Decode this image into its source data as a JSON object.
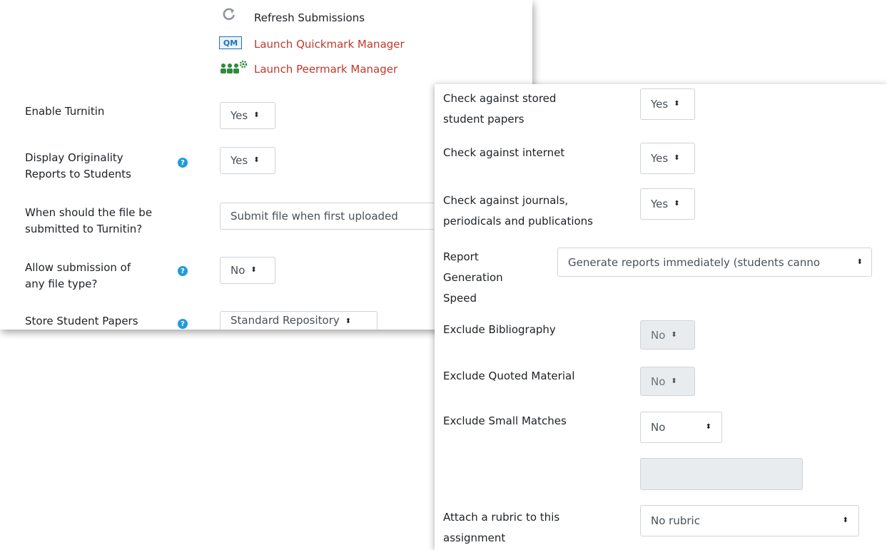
{
  "links": {
    "refresh": "Refresh Submissions",
    "quickmark": "Launch Quickmark Manager",
    "quickmark_badge": "QM",
    "peermark": "Launch Peermark Manager"
  },
  "left": {
    "enable_turnitin": {
      "label": "Enable Turnitin",
      "value": "Yes"
    },
    "display_reports": {
      "label_1": "Display Originality",
      "label_2": "Reports to Students",
      "value": "Yes"
    },
    "when_submit": {
      "label_1": "When should the file be",
      "label_2": "submitted to Turnitin?",
      "value": "Submit file when first uploaded"
    },
    "allow_any": {
      "label_1": "Allow submission of",
      "label_2": "any file type?",
      "value": "No"
    },
    "store_papers": {
      "label": "Store Student Papers",
      "value": "Standard Repository"
    }
  },
  "right": {
    "stored": {
      "label_1": "Check against stored",
      "label_2": "student papers",
      "value": "Yes"
    },
    "internet": {
      "label": "Check against internet",
      "value": "Yes"
    },
    "journals": {
      "label_1": "Check against journals,",
      "label_2": "periodicals and publications",
      "value": "Yes"
    },
    "speed": {
      "label_1": "Report",
      "label_2": "Generation",
      "label_3": "Speed",
      "value": "Generate reports immediately (students canno"
    },
    "bibliography": {
      "label": "Exclude Bibliography",
      "value": "No"
    },
    "quoted": {
      "label": "Exclude Quoted Material",
      "value": "No"
    },
    "small": {
      "label": "Exclude Small Matches",
      "value": "No"
    },
    "rubric": {
      "label_1": "Attach a rubric to this",
      "label_2": "assignment",
      "value": "No rubric"
    }
  },
  "icons": {
    "caret": "⬍",
    "help": "?"
  },
  "colors": {
    "link_red": "#c0392b",
    "help_blue": "#1f9cd8",
    "qm_blue": "#1a73b8",
    "peermark_green": "#2e8b3a"
  }
}
